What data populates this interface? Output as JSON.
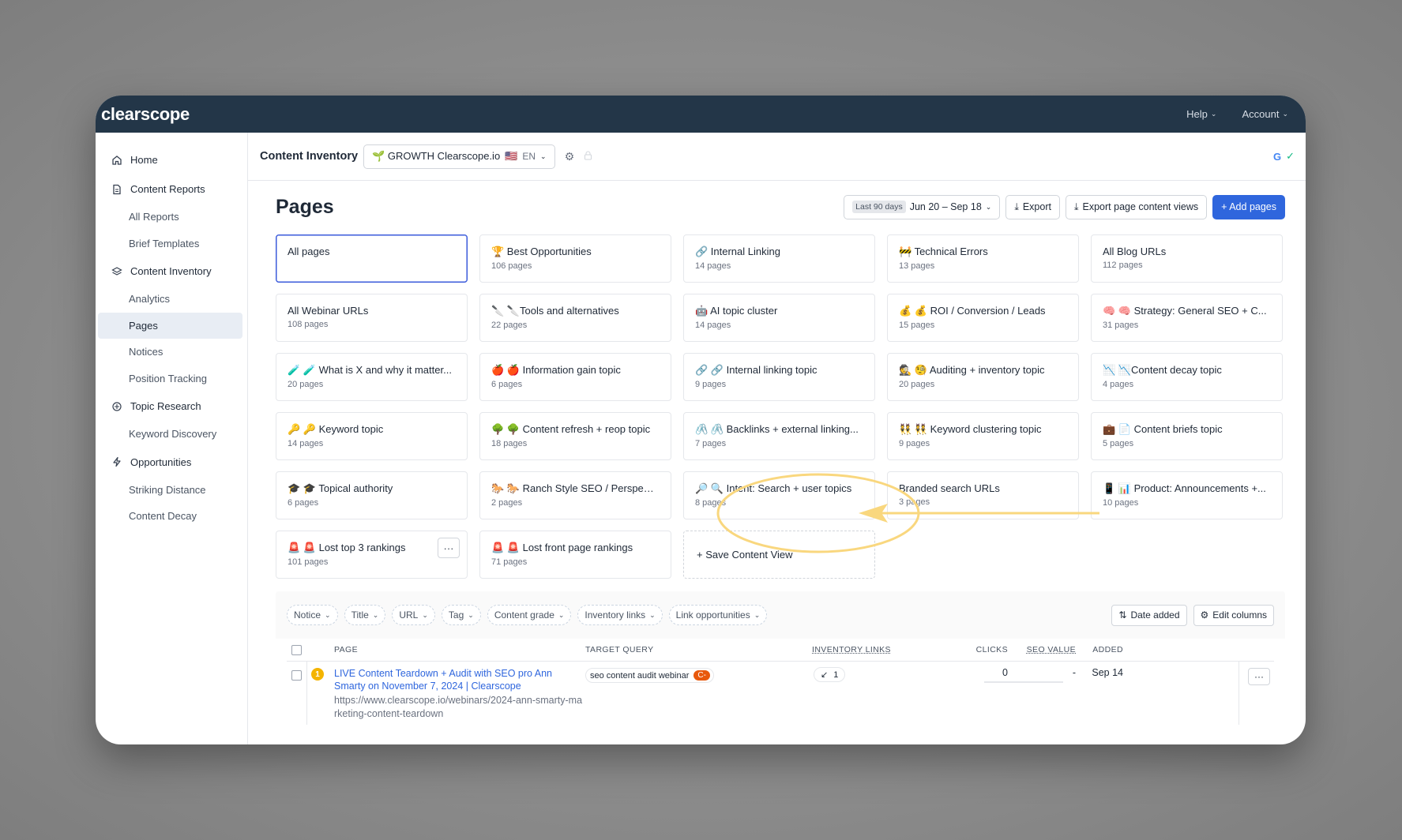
{
  "topbar": {
    "logo": "clearscope",
    "help": "Help",
    "account": "Account"
  },
  "sidebar": {
    "home": "Home",
    "content_reports": "Content Reports",
    "all_reports": "All Reports",
    "brief_templates": "Brief Templates",
    "content_inventory": "Content Inventory",
    "analytics": "Analytics",
    "pages": "Pages",
    "notices": "Notices",
    "position_tracking": "Position Tracking",
    "topic_research": "Topic Research",
    "keyword_discovery": "Keyword Discovery",
    "opportunities": "Opportunities",
    "striking_distance": "Striking Distance",
    "content_decay": "Content Decay"
  },
  "header": {
    "title": "Content Inventory",
    "workspace": "🌱 GROWTH Clearscope.io",
    "flag": "🇺🇸",
    "lang": "EN",
    "google": "G"
  },
  "pages_section": {
    "title": "Pages",
    "date_tag": "Last 90 days",
    "date_range": "Jun 20 – Sep 18",
    "export": "Export",
    "export_views": "Export page content views",
    "add_pages": "+ Add pages"
  },
  "views": [
    {
      "title": "All pages",
      "sub": ""
    },
    {
      "title": "🏆 Best Opportunities",
      "sub": "106 pages"
    },
    {
      "title": "🔗 Internal Linking",
      "sub": "14 pages"
    },
    {
      "title": "🚧 Technical Errors",
      "sub": "13 pages"
    },
    {
      "title": "All Blog URLs",
      "sub": "112 pages"
    },
    {
      "title": "All Webinar URLs",
      "sub": "108 pages"
    },
    {
      "title": "🔪 🔪Tools and alternatives",
      "sub": "22 pages"
    },
    {
      "title": "🤖 AI topic cluster",
      "sub": "14 pages"
    },
    {
      "title": "💰 💰 ROI / Conversion / Leads",
      "sub": "15 pages"
    },
    {
      "title": "🧠 🧠 Strategy: General SEO + C...",
      "sub": "31 pages"
    },
    {
      "title": "🧪 🧪 What is X and why it matter...",
      "sub": "20 pages"
    },
    {
      "title": "🍎 🍎 Information gain topic",
      "sub": "6 pages"
    },
    {
      "title": "🔗 🔗 Internal linking topic",
      "sub": "9 pages"
    },
    {
      "title": "🕵️ 🧐 Auditing + inventory topic",
      "sub": "20 pages"
    },
    {
      "title": "📉 📉Content decay topic",
      "sub": "4 pages"
    },
    {
      "title": "🔑 🔑 Keyword topic",
      "sub": "14 pages"
    },
    {
      "title": "🌳 🌳 Content refresh + reop topic",
      "sub": "18 pages"
    },
    {
      "title": "🖇️ 🖇️ Backlinks + external linking...",
      "sub": "7 pages"
    },
    {
      "title": "👯 👯 Keyword clustering topic",
      "sub": "9 pages"
    },
    {
      "title": "💼 📄 Content briefs topic",
      "sub": "5 pages"
    },
    {
      "title": "🎓 🎓 Topical authority",
      "sub": "6 pages"
    },
    {
      "title": "🐎 🐎 Ranch Style SEO / Perspect...",
      "sub": "2 pages"
    },
    {
      "title": "🔎 🔍 Intent: Search + user topics",
      "sub": "8 pages"
    },
    {
      "title": "Branded search URLs",
      "sub": "3 pages"
    },
    {
      "title": "📱 📊 Product: Announcements +...",
      "sub": "10 pages"
    },
    {
      "title": "🚨 🚨 Lost top 3 rankings",
      "sub": "101 pages"
    },
    {
      "title": "🚨 🚨 Lost front page rankings",
      "sub": "71 pages"
    }
  ],
  "save_view": "+ Save Content View",
  "filters": [
    "Notice",
    "Title",
    "URL",
    "Tag",
    "Content grade",
    "Inventory links",
    "Link opportunities"
  ],
  "sort_label": "Date added",
  "edit_columns": "Edit columns",
  "table": {
    "headers": {
      "page": "PAGE",
      "query": "TARGET QUERY",
      "links": "INVENTORY LINKS",
      "clicks": "CLICKS",
      "seo": "SEO VALUE",
      "added": "ADDED"
    },
    "rows": [
      {
        "num": "1",
        "title": "LIVE Content Teardown + Audit with SEO pro Ann Smarty on November 7, 2024 | Clearscope",
        "url": "https://www.clearscope.io/webinars/2024-ann-smarty-marketing-content-teardown",
        "query": "seo content audit webinar",
        "grade": "C-",
        "links": "1",
        "clicks": "0",
        "seo": "-",
        "added": "Sep 14"
      }
    ]
  },
  "colors": {
    "nav": "#233648",
    "primary": "#2f66dd",
    "highlight": "#f9d77e"
  }
}
